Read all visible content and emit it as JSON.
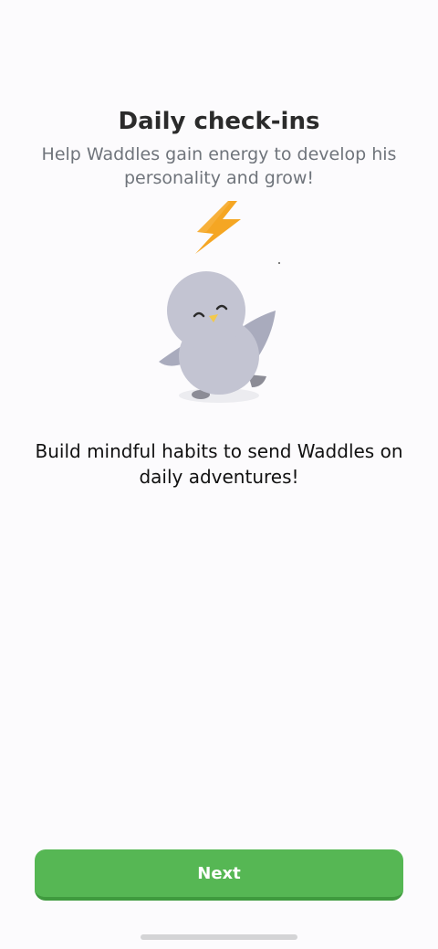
{
  "header": {
    "title": "Daily check-ins",
    "subtitle": "Help Waddles gain energy to develop his personality and grow!"
  },
  "illustration": {
    "icon": "lightning-bolt-icon",
    "character": "waddles-penguin",
    "colors": {
      "bolt": "#f5a623",
      "penguin_body": "#c3c4d2",
      "penguin_wing": "#a9abbd",
      "beak": "#f2c94c"
    }
  },
  "main": {
    "description": "Build mindful habits to send Waddles on daily adventures!"
  },
  "footer": {
    "next_label": "Next"
  },
  "colors": {
    "background": "#fcfbfd",
    "accent": "#56b754",
    "accent_shadow": "#3f9a3e",
    "title": "#2b2b2b",
    "subtitle": "#6f747b"
  }
}
